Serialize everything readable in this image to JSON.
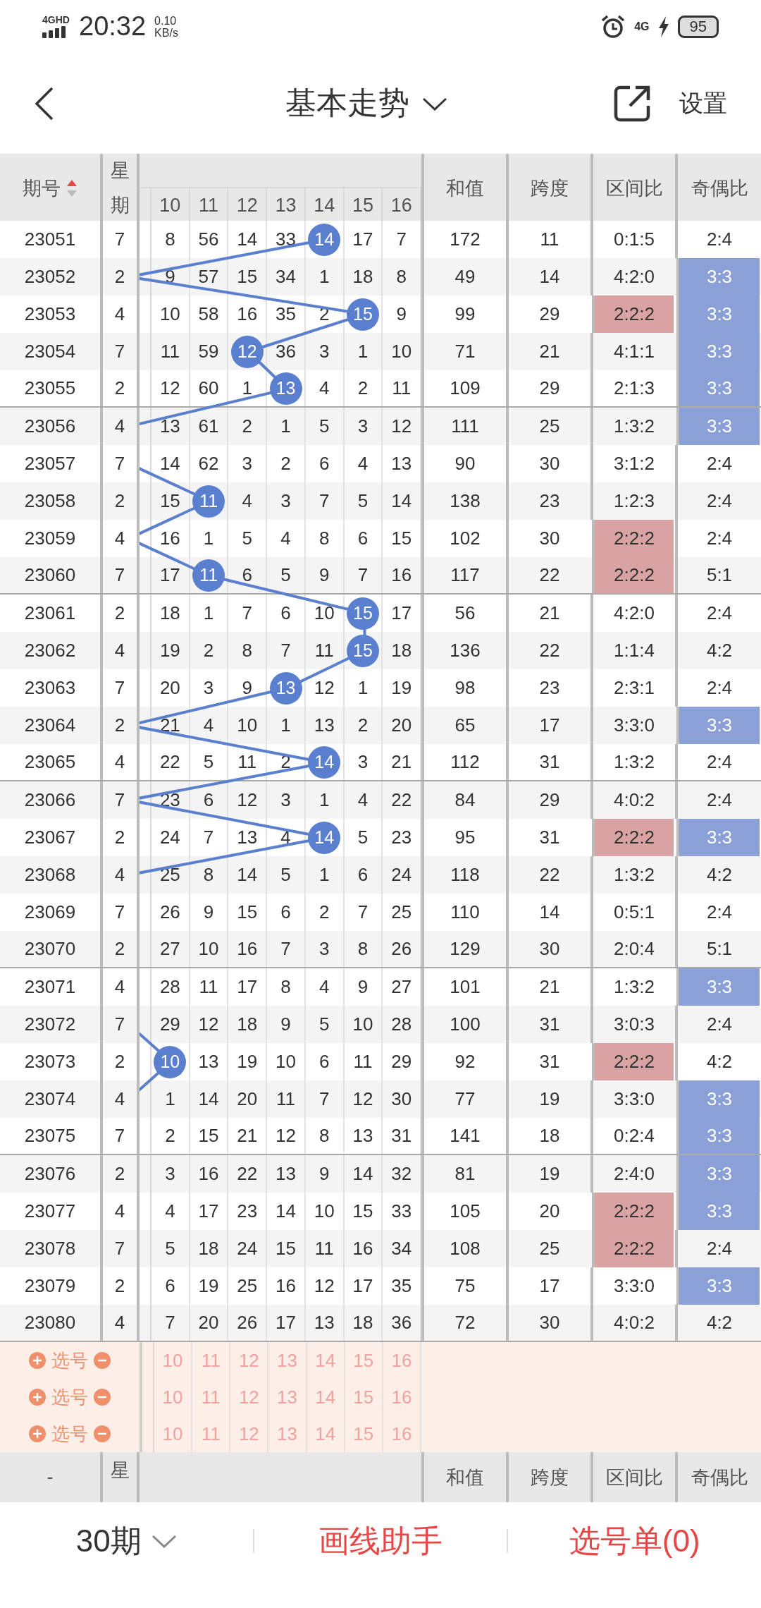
{
  "status_bar": {
    "network": "4GHD",
    "time": "20:32",
    "speed_value": "0.10",
    "speed_unit": "KB/s",
    "mobile": "4G",
    "battery": "95"
  },
  "header": {
    "title": "基本走势",
    "settings": "设置"
  },
  "table": {
    "columns": {
      "issue": "期号",
      "weekday_top": "星",
      "weekday_bottom": "期",
      "numbers": [
        "10",
        "11",
        "12",
        "13",
        "14",
        "15",
        "16"
      ],
      "sum": "和值",
      "span": "跨度",
      "zone_ratio": "区间比",
      "odd_even": "奇偶比"
    },
    "rows": [
      {
        "issue": "23051",
        "weekday": "7",
        "cells": [
          "8",
          "56",
          "14",
          "33",
          "14",
          "17",
          "7"
        ],
        "balls": [
          false,
          false,
          false,
          false,
          true,
          false,
          false
        ],
        "sum": "172",
        "span": "11",
        "zone_ratio": "0:1:5",
        "zone_highlight": false,
        "odd_even": "2:4",
        "odd_even_highlight": false
      },
      {
        "issue": "23052",
        "weekday": "2",
        "cells": [
          "9",
          "57",
          "15",
          "34",
          "1",
          "18",
          "8"
        ],
        "balls": [
          false,
          false,
          false,
          false,
          false,
          false,
          false
        ],
        "sum": "49",
        "span": "14",
        "zone_ratio": "4:2:0",
        "zone_highlight": false,
        "odd_even": "3:3",
        "odd_even_highlight": true
      },
      {
        "issue": "23053",
        "weekday": "4",
        "cells": [
          "10",
          "58",
          "16",
          "35",
          "2",
          "15",
          "9"
        ],
        "balls": [
          false,
          false,
          false,
          false,
          false,
          true,
          false
        ],
        "sum": "99",
        "span": "29",
        "zone_ratio": "2:2:2",
        "zone_highlight": true,
        "odd_even": "3:3",
        "odd_even_highlight": true
      },
      {
        "issue": "23054",
        "weekday": "7",
        "cells": [
          "11",
          "59",
          "12",
          "36",
          "3",
          "1",
          "10"
        ],
        "balls": [
          false,
          false,
          true,
          false,
          false,
          false,
          false
        ],
        "sum": "71",
        "span": "21",
        "zone_ratio": "4:1:1",
        "zone_highlight": false,
        "odd_even": "3:3",
        "odd_even_highlight": true
      },
      {
        "issue": "23055",
        "weekday": "2",
        "cells": [
          "12",
          "60",
          "1",
          "13",
          "4",
          "2",
          "11"
        ],
        "balls": [
          false,
          false,
          false,
          true,
          false,
          false,
          false
        ],
        "sum": "109",
        "span": "29",
        "zone_ratio": "2:1:3",
        "zone_highlight": false,
        "odd_even": "3:3",
        "odd_even_highlight": true
      },
      {
        "issue": "23056",
        "weekday": "4",
        "cells": [
          "13",
          "61",
          "2",
          "1",
          "5",
          "3",
          "12"
        ],
        "balls": [
          false,
          false,
          false,
          false,
          false,
          false,
          false
        ],
        "sum": "111",
        "span": "25",
        "zone_ratio": "1:3:2",
        "zone_highlight": false,
        "odd_even": "3:3",
        "odd_even_highlight": true
      },
      {
        "issue": "23057",
        "weekday": "7",
        "cells": [
          "14",
          "62",
          "3",
          "2",
          "6",
          "4",
          "13"
        ],
        "balls": [
          false,
          false,
          false,
          false,
          false,
          false,
          false
        ],
        "sum": "90",
        "span": "30",
        "zone_ratio": "3:1:2",
        "zone_highlight": false,
        "odd_even": "2:4",
        "odd_even_highlight": false
      },
      {
        "issue": "23058",
        "weekday": "2",
        "cells": [
          "15",
          "11",
          "4",
          "3",
          "7",
          "5",
          "14"
        ],
        "balls": [
          false,
          true,
          false,
          false,
          false,
          false,
          false
        ],
        "sum": "138",
        "span": "23",
        "zone_ratio": "1:2:3",
        "zone_highlight": false,
        "odd_even": "2:4",
        "odd_even_highlight": false
      },
      {
        "issue": "23059",
        "weekday": "4",
        "cells": [
          "16",
          "1",
          "5",
          "4",
          "8",
          "6",
          "15"
        ],
        "balls": [
          false,
          false,
          false,
          false,
          false,
          false,
          false
        ],
        "sum": "102",
        "span": "30",
        "zone_ratio": "2:2:2",
        "zone_highlight": true,
        "odd_even": "2:4",
        "odd_even_highlight": false
      },
      {
        "issue": "23060",
        "weekday": "7",
        "cells": [
          "17",
          "11",
          "6",
          "5",
          "9",
          "7",
          "16"
        ],
        "balls": [
          false,
          true,
          false,
          false,
          false,
          false,
          false
        ],
        "sum": "117",
        "span": "22",
        "zone_ratio": "2:2:2",
        "zone_highlight": true,
        "odd_even": "5:1",
        "odd_even_highlight": false
      },
      {
        "issue": "23061",
        "weekday": "2",
        "cells": [
          "18",
          "1",
          "7",
          "6",
          "10",
          "15",
          "17"
        ],
        "balls": [
          false,
          false,
          false,
          false,
          false,
          true,
          false
        ],
        "sum": "56",
        "span": "21",
        "zone_ratio": "4:2:0",
        "zone_highlight": false,
        "odd_even": "2:4",
        "odd_even_highlight": false
      },
      {
        "issue": "23062",
        "weekday": "4",
        "cells": [
          "19",
          "2",
          "8",
          "7",
          "11",
          "15",
          "18"
        ],
        "balls": [
          false,
          false,
          false,
          false,
          false,
          true,
          false
        ],
        "sum": "136",
        "span": "22",
        "zone_ratio": "1:1:4",
        "zone_highlight": false,
        "odd_even": "4:2",
        "odd_even_highlight": false
      },
      {
        "issue": "23063",
        "weekday": "7",
        "cells": [
          "20",
          "3",
          "9",
          "13",
          "12",
          "1",
          "19"
        ],
        "balls": [
          false,
          false,
          false,
          true,
          false,
          false,
          false
        ],
        "sum": "98",
        "span": "23",
        "zone_ratio": "2:3:1",
        "zone_highlight": false,
        "odd_even": "2:4",
        "odd_even_highlight": false
      },
      {
        "issue": "23064",
        "weekday": "2",
        "cells": [
          "21",
          "4",
          "10",
          "1",
          "13",
          "2",
          "20"
        ],
        "balls": [
          false,
          false,
          false,
          false,
          false,
          false,
          false
        ],
        "sum": "65",
        "span": "17",
        "zone_ratio": "3:3:0",
        "zone_highlight": false,
        "odd_even": "3:3",
        "odd_even_highlight": true
      },
      {
        "issue": "23065",
        "weekday": "4",
        "cells": [
          "22",
          "5",
          "11",
          "2",
          "14",
          "3",
          "21"
        ],
        "balls": [
          false,
          false,
          false,
          false,
          true,
          false,
          false
        ],
        "sum": "112",
        "span": "31",
        "zone_ratio": "1:3:2",
        "zone_highlight": false,
        "odd_even": "2:4",
        "odd_even_highlight": false
      },
      {
        "issue": "23066",
        "weekday": "7",
        "cells": [
          "23",
          "6",
          "12",
          "3",
          "1",
          "4",
          "22"
        ],
        "balls": [
          false,
          false,
          false,
          false,
          false,
          false,
          false
        ],
        "sum": "84",
        "span": "29",
        "zone_ratio": "4:0:2",
        "zone_highlight": false,
        "odd_even": "2:4",
        "odd_even_highlight": false
      },
      {
        "issue": "23067",
        "weekday": "2",
        "cells": [
          "24",
          "7",
          "13",
          "4",
          "14",
          "5",
          "23"
        ],
        "balls": [
          false,
          false,
          false,
          false,
          true,
          false,
          false
        ],
        "sum": "95",
        "span": "31",
        "zone_ratio": "2:2:2",
        "zone_highlight": true,
        "odd_even": "3:3",
        "odd_even_highlight": true
      },
      {
        "issue": "23068",
        "weekday": "4",
        "cells": [
          "25",
          "8",
          "14",
          "5",
          "1",
          "6",
          "24"
        ],
        "balls": [
          false,
          false,
          false,
          false,
          false,
          false,
          false
        ],
        "sum": "118",
        "span": "22",
        "zone_ratio": "1:3:2",
        "zone_highlight": false,
        "odd_even": "4:2",
        "odd_even_highlight": false
      },
      {
        "issue": "23069",
        "weekday": "7",
        "cells": [
          "26",
          "9",
          "15",
          "6",
          "2",
          "7",
          "25"
        ],
        "balls": [
          false,
          false,
          false,
          false,
          false,
          false,
          false
        ],
        "sum": "110",
        "span": "14",
        "zone_ratio": "0:5:1",
        "zone_highlight": false,
        "odd_even": "2:4",
        "odd_even_highlight": false
      },
      {
        "issue": "23070",
        "weekday": "2",
        "cells": [
          "27",
          "10",
          "16",
          "7",
          "3",
          "8",
          "26"
        ],
        "balls": [
          false,
          false,
          false,
          false,
          false,
          false,
          false
        ],
        "sum": "129",
        "span": "30",
        "zone_ratio": "2:0:4",
        "zone_highlight": false,
        "odd_even": "5:1",
        "odd_even_highlight": false
      },
      {
        "issue": "23071",
        "weekday": "4",
        "cells": [
          "28",
          "11",
          "17",
          "8",
          "4",
          "9",
          "27"
        ],
        "balls": [
          false,
          false,
          false,
          false,
          false,
          false,
          false
        ],
        "sum": "101",
        "span": "21",
        "zone_ratio": "1:3:2",
        "zone_highlight": false,
        "odd_even": "3:3",
        "odd_even_highlight": true
      },
      {
        "issue": "23072",
        "weekday": "7",
        "cells": [
          "29",
          "12",
          "18",
          "9",
          "5",
          "10",
          "28"
        ],
        "balls": [
          false,
          false,
          false,
          false,
          false,
          false,
          false
        ],
        "sum": "100",
        "span": "31",
        "zone_ratio": "3:0:3",
        "zone_highlight": false,
        "odd_even": "2:4",
        "odd_even_highlight": false
      },
      {
        "issue": "23073",
        "weekday": "2",
        "cells": [
          "10",
          "13",
          "19",
          "10",
          "6",
          "11",
          "29"
        ],
        "balls": [
          true,
          false,
          false,
          false,
          false,
          false,
          false
        ],
        "sum": "92",
        "span": "31",
        "zone_ratio": "2:2:2",
        "zone_highlight": true,
        "odd_even": "4:2",
        "odd_even_highlight": false
      },
      {
        "issue": "23074",
        "weekday": "4",
        "cells": [
          "1",
          "14",
          "20",
          "11",
          "7",
          "12",
          "30"
        ],
        "balls": [
          false,
          false,
          false,
          false,
          false,
          false,
          false
        ],
        "sum": "77",
        "span": "19",
        "zone_ratio": "3:3:0",
        "zone_highlight": false,
        "odd_even": "3:3",
        "odd_even_highlight": true
      },
      {
        "issue": "23075",
        "weekday": "7",
        "cells": [
          "2",
          "15",
          "21",
          "12",
          "8",
          "13",
          "31"
        ],
        "balls": [
          false,
          false,
          false,
          false,
          false,
          false,
          false
        ],
        "sum": "141",
        "span": "18",
        "zone_ratio": "0:2:4",
        "zone_highlight": false,
        "odd_even": "3:3",
        "odd_even_highlight": true
      },
      {
        "issue": "23076",
        "weekday": "2",
        "cells": [
          "3",
          "16",
          "22",
          "13",
          "9",
          "14",
          "32"
        ],
        "balls": [
          false,
          false,
          false,
          false,
          false,
          false,
          false
        ],
        "sum": "81",
        "span": "19",
        "zone_ratio": "2:4:0",
        "zone_highlight": false,
        "odd_even": "3:3",
        "odd_even_highlight": true
      },
      {
        "issue": "23077",
        "weekday": "4",
        "cells": [
          "4",
          "17",
          "23",
          "14",
          "10",
          "15",
          "33"
        ],
        "balls": [
          false,
          false,
          false,
          false,
          false,
          false,
          false
        ],
        "sum": "105",
        "span": "20",
        "zone_ratio": "2:2:2",
        "zone_highlight": true,
        "odd_even": "3:3",
        "odd_even_highlight": true
      },
      {
        "issue": "23078",
        "weekday": "7",
        "cells": [
          "5",
          "18",
          "24",
          "15",
          "11",
          "16",
          "34"
        ],
        "balls": [
          false,
          false,
          false,
          false,
          false,
          false,
          false
        ],
        "sum": "108",
        "span": "25",
        "zone_ratio": "2:2:2",
        "zone_highlight": true,
        "odd_even": "2:4",
        "odd_even_highlight": false
      },
      {
        "issue": "23079",
        "weekday": "2",
        "cells": [
          "6",
          "19",
          "25",
          "16",
          "12",
          "17",
          "35"
        ],
        "balls": [
          false,
          false,
          false,
          false,
          false,
          false,
          false
        ],
        "sum": "75",
        "span": "17",
        "zone_ratio": "3:3:0",
        "zone_highlight": false,
        "odd_even": "3:3",
        "odd_even_highlight": true
      },
      {
        "issue": "23080",
        "weekday": "4",
        "cells": [
          "7",
          "20",
          "26",
          "17",
          "13",
          "18",
          "36"
        ],
        "balls": [
          false,
          false,
          false,
          false,
          false,
          false,
          false
        ],
        "sum": "72",
        "span": "30",
        "zone_ratio": "4:0:2",
        "zone_highlight": false,
        "odd_even": "4:2",
        "odd_even_highlight": false
      }
    ],
    "pick_rows": [
      {
        "label": "选号",
        "numbers": [
          "10",
          "11",
          "12",
          "13",
          "14",
          "15",
          "16"
        ]
      },
      {
        "label": "选号",
        "numbers": [
          "10",
          "11",
          "12",
          "13",
          "14",
          "15",
          "16"
        ]
      },
      {
        "label": "选号",
        "numbers": [
          "10",
          "11",
          "12",
          "13",
          "14",
          "15",
          "16"
        ]
      }
    ],
    "footer_header": {
      "issue": "-",
      "weekday_top": "星",
      "sum": "和值",
      "span": "跨度",
      "zone_ratio": "区间比",
      "odd_even": "奇偶比"
    }
  },
  "bottom_bar": {
    "periods": "30期",
    "draw_helper": "画线助手",
    "pick_list": "选号单(0)"
  }
}
